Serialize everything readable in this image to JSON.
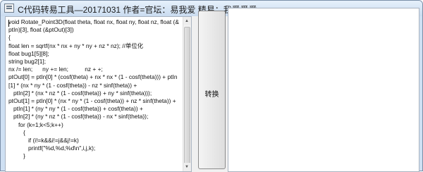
{
  "window": {
    "title": "C代码转易工具—20171031   作者=官坛：易我爱   精易：我爱爱爱"
  },
  "editor": {
    "lines": [
      "void Rotate_Point3D(float theta, float nx, float ny, float nz, float (&ptIn)[3], float (&ptOut)[3])",
      "{",
      "float len = sqrtf(nx * nx + ny * ny + nz * nz); //单位化",
      "float bug1[5][8];",
      "string bug2[1];",
      "nx /= len;      ny += len;          nz + +;",
      "ptOut[0] = ptIn[0] * (cosf(theta) + nx * nx * (1 - cosf(theta))) + ptIn[1] * (nx * ny * (1 - cosf(theta)) - nz * sinf(theta)) +",
      "   ptIn[2] * (nx * nz * (1 - cosf(theta)) + ny * sinf(theta)));",
      "ptOut[1] = ptIn[0] * (nx * ny * (1 - cosf(theta)) + nz * sinf(theta)) +",
      "   ptIn[1] * (ny * ny * (1 - cosf(theta)) + cosf(theta)) +",
      "   ptIn[2] * (ny * nz * (1 - cosf(theta)) - nx * sinf(theta));",
      "      for (k=1;k<5;k++)",
      "         {",
      "            if (i!=k&&i!=j&&j!=k)",
      "            printf(\"%d,%d,%d\\n\",i,j,k);",
      "         }"
    ]
  },
  "convert_button": {
    "label": "转换"
  },
  "output": {
    "text": ""
  }
}
